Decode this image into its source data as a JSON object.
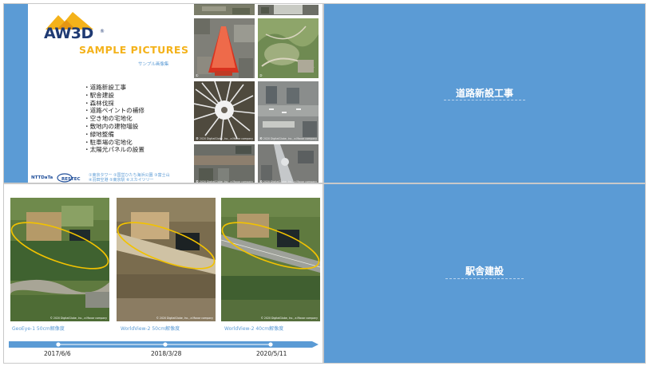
{
  "slide1": {
    "logo": "AW3D",
    "logo_mark": "®",
    "title": "SAMPLE PICTURES",
    "subtitle": "サンプル画像集",
    "bullets": [
      "・道路新設工事",
      "・駅舎建設",
      "・森林伐採",
      "・道路ペイントの補修",
      "・空き地の宅地化",
      "・敷地内の建物増設",
      "・緑地整備",
      "・駐車場の宅地化",
      "・太陽光パネルの設置"
    ],
    "captions": [
      "①東京タワー ②国営ひたち海浜公園 ③富士山",
      "④羽田空港 ⑤東京駅 ⑥スカイツリー"
    ],
    "ntt_logo": "NTTDaTa",
    "restec_logo": "RESTEC",
    "photo_labels": [
      "①",
      "②",
      "③",
      "④",
      "⑤",
      "⑥"
    ],
    "photo_copyright": "© 2020 DigitalGlobe, Inc., a Maxar company"
  },
  "slide2": {
    "title": "道路新設工事"
  },
  "slide3": {
    "images": [
      {
        "caption": "GeoEye-1  50cm解像度",
        "copyright": "© 2020 DigitalGlobe, Inc., a Maxar company"
      },
      {
        "caption": "WorldView-2  50cm解像度",
        "copyright": "© 2020 DigitalGlobe, Inc., a Maxar company"
      },
      {
        "caption": "WorldView-2 40cm解像度",
        "copyright": "© 2020 DigitalGlobe, Inc., a Maxar company"
      }
    ],
    "timeline_dates": [
      "2017/6/6",
      "2018/3/28",
      "2020/5/11"
    ]
  },
  "slide4": {
    "title": "駅舎建設"
  },
  "colors": {
    "accent_blue": "#5b9bd5",
    "logo_navy": "#1f3a73",
    "title_gold": "#f4b21a",
    "ellipse_yellow": "#f2c200"
  }
}
